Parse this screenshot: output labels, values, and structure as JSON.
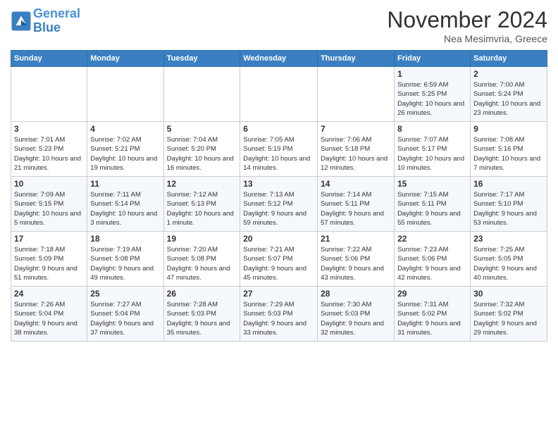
{
  "header": {
    "logo_line1": "General",
    "logo_line2": "Blue",
    "month": "November 2024",
    "location": "Nea Mesimvria, Greece"
  },
  "days_of_week": [
    "Sunday",
    "Monday",
    "Tuesday",
    "Wednesday",
    "Thursday",
    "Friday",
    "Saturday"
  ],
  "weeks": [
    [
      {
        "day": "",
        "info": ""
      },
      {
        "day": "",
        "info": ""
      },
      {
        "day": "",
        "info": ""
      },
      {
        "day": "",
        "info": ""
      },
      {
        "day": "",
        "info": ""
      },
      {
        "day": "1",
        "info": "Sunrise: 6:59 AM\nSunset: 5:25 PM\nDaylight: 10 hours and 26 minutes."
      },
      {
        "day": "2",
        "info": "Sunrise: 7:00 AM\nSunset: 5:24 PM\nDaylight: 10 hours and 23 minutes."
      }
    ],
    [
      {
        "day": "3",
        "info": "Sunrise: 7:01 AM\nSunset: 5:23 PM\nDaylight: 10 hours and 21 minutes."
      },
      {
        "day": "4",
        "info": "Sunrise: 7:02 AM\nSunset: 5:21 PM\nDaylight: 10 hours and 19 minutes."
      },
      {
        "day": "5",
        "info": "Sunrise: 7:04 AM\nSunset: 5:20 PM\nDaylight: 10 hours and 16 minutes."
      },
      {
        "day": "6",
        "info": "Sunrise: 7:05 AM\nSunset: 5:19 PM\nDaylight: 10 hours and 14 minutes."
      },
      {
        "day": "7",
        "info": "Sunrise: 7:06 AM\nSunset: 5:18 PM\nDaylight: 10 hours and 12 minutes."
      },
      {
        "day": "8",
        "info": "Sunrise: 7:07 AM\nSunset: 5:17 PM\nDaylight: 10 hours and 10 minutes."
      },
      {
        "day": "9",
        "info": "Sunrise: 7:08 AM\nSunset: 5:16 PM\nDaylight: 10 hours and 7 minutes."
      }
    ],
    [
      {
        "day": "10",
        "info": "Sunrise: 7:09 AM\nSunset: 5:15 PM\nDaylight: 10 hours and 5 minutes."
      },
      {
        "day": "11",
        "info": "Sunrise: 7:11 AM\nSunset: 5:14 PM\nDaylight: 10 hours and 3 minutes."
      },
      {
        "day": "12",
        "info": "Sunrise: 7:12 AM\nSunset: 5:13 PM\nDaylight: 10 hours and 1 minute."
      },
      {
        "day": "13",
        "info": "Sunrise: 7:13 AM\nSunset: 5:12 PM\nDaylight: 9 hours and 59 minutes."
      },
      {
        "day": "14",
        "info": "Sunrise: 7:14 AM\nSunset: 5:11 PM\nDaylight: 9 hours and 57 minutes."
      },
      {
        "day": "15",
        "info": "Sunrise: 7:15 AM\nSunset: 5:11 PM\nDaylight: 9 hours and 55 minutes."
      },
      {
        "day": "16",
        "info": "Sunrise: 7:17 AM\nSunset: 5:10 PM\nDaylight: 9 hours and 53 minutes."
      }
    ],
    [
      {
        "day": "17",
        "info": "Sunrise: 7:18 AM\nSunset: 5:09 PM\nDaylight: 9 hours and 51 minutes."
      },
      {
        "day": "18",
        "info": "Sunrise: 7:19 AM\nSunset: 5:08 PM\nDaylight: 9 hours and 49 minutes."
      },
      {
        "day": "19",
        "info": "Sunrise: 7:20 AM\nSunset: 5:08 PM\nDaylight: 9 hours and 47 minutes."
      },
      {
        "day": "20",
        "info": "Sunrise: 7:21 AM\nSunset: 5:07 PM\nDaylight: 9 hours and 45 minutes."
      },
      {
        "day": "21",
        "info": "Sunrise: 7:22 AM\nSunset: 5:06 PM\nDaylight: 9 hours and 43 minutes."
      },
      {
        "day": "22",
        "info": "Sunrise: 7:23 AM\nSunset: 5:06 PM\nDaylight: 9 hours and 42 minutes."
      },
      {
        "day": "23",
        "info": "Sunrise: 7:25 AM\nSunset: 5:05 PM\nDaylight: 9 hours and 40 minutes."
      }
    ],
    [
      {
        "day": "24",
        "info": "Sunrise: 7:26 AM\nSunset: 5:04 PM\nDaylight: 9 hours and 38 minutes."
      },
      {
        "day": "25",
        "info": "Sunrise: 7:27 AM\nSunset: 5:04 PM\nDaylight: 9 hours and 37 minutes."
      },
      {
        "day": "26",
        "info": "Sunrise: 7:28 AM\nSunset: 5:03 PM\nDaylight: 9 hours and 35 minutes."
      },
      {
        "day": "27",
        "info": "Sunrise: 7:29 AM\nSunset: 5:03 PM\nDaylight: 9 hours and 33 minutes."
      },
      {
        "day": "28",
        "info": "Sunrise: 7:30 AM\nSunset: 5:03 PM\nDaylight: 9 hours and 32 minutes."
      },
      {
        "day": "29",
        "info": "Sunrise: 7:31 AM\nSunset: 5:02 PM\nDaylight: 9 hours and 31 minutes."
      },
      {
        "day": "30",
        "info": "Sunrise: 7:32 AM\nSunset: 5:02 PM\nDaylight: 9 hours and 29 minutes."
      }
    ]
  ]
}
